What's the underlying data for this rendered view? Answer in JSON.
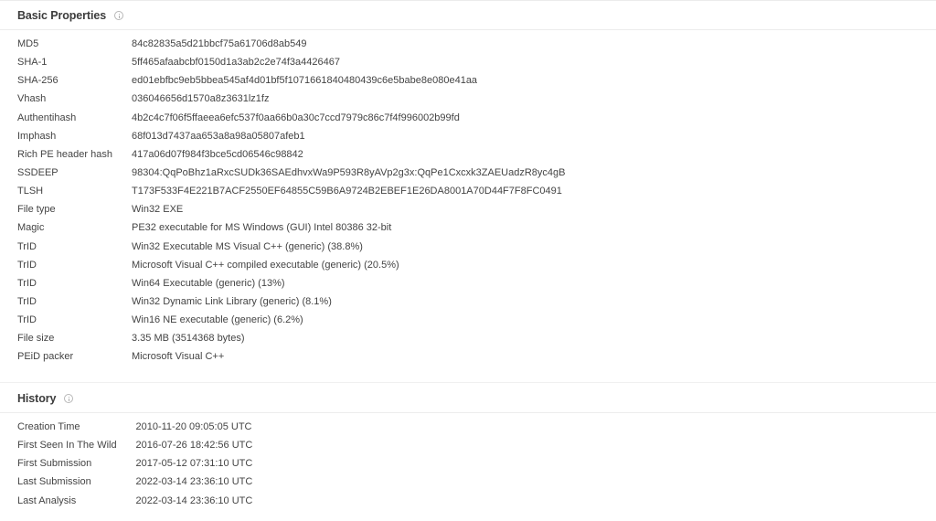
{
  "basic": {
    "title": "Basic Properties",
    "rows": [
      {
        "label": "MD5",
        "value": "84c82835a5d21bbcf75a61706d8ab549"
      },
      {
        "label": "SHA-1",
        "value": "5ff465afaabcbf0150d1a3ab2c2e74f3a4426467"
      },
      {
        "label": "SHA-256",
        "value": "ed01ebfbc9eb5bbea545af4d01bf5f1071661840480439c6e5babe8e080e41aa"
      },
      {
        "label": "Vhash",
        "value": "036046656d1570a8z3631lz1fz"
      },
      {
        "label": "Authentihash",
        "value": "4b2c4c7f06f5ffaeea6efc537f0aa66b0a30c7ccd7979c86c7f4f996002b99fd"
      },
      {
        "label": "Imphash",
        "value": "68f013d7437aa653a8a98a05807afeb1"
      },
      {
        "label": "Rich PE header hash",
        "value": "417a06d07f984f3bce5cd06546c98842"
      },
      {
        "label": "SSDEEP",
        "value": "98304:QqPoBhz1aRxcSUDk36SAEdhvxWa9P593R8yAVp2g3x:QqPe1Cxcxk3ZAEUadzR8yc4gB"
      },
      {
        "label": "TLSH",
        "value": "T173F533F4E221B7ACF2550EF64855C59B6A9724B2EBEF1E26DA8001A70D44F7F8FC0491"
      },
      {
        "label": "File type",
        "value": "Win32 EXE"
      },
      {
        "label": "Magic",
        "value": "PE32 executable for MS Windows (GUI) Intel 80386 32-bit"
      },
      {
        "label": "TrID",
        "value": "Win32 Executable MS Visual C++ (generic) (38.8%)"
      },
      {
        "label": "TrID",
        "value": "Microsoft Visual C++ compiled executable (generic) (20.5%)"
      },
      {
        "label": "TrID",
        "value": "Win64 Executable (generic) (13%)"
      },
      {
        "label": "TrID",
        "value": "Win32 Dynamic Link Library (generic) (8.1%)"
      },
      {
        "label": "TrID",
        "value": "Win16 NE executable (generic) (6.2%)"
      },
      {
        "label": "File size",
        "value": "3.35 MB (3514368 bytes)"
      },
      {
        "label": "PEiD packer",
        "value": "Microsoft Visual C++"
      }
    ]
  },
  "history": {
    "title": "History",
    "rows": [
      {
        "label": "Creation Time",
        "value": "2010-11-20 09:05:05 UTC"
      },
      {
        "label": "First Seen In The Wild",
        "value": "2016-07-26 18:42:56 UTC"
      },
      {
        "label": "First Submission",
        "value": "2017-05-12 07:31:10 UTC"
      },
      {
        "label": "Last Submission",
        "value": "2022-03-14 23:36:10 UTC"
      },
      {
        "label": "Last Analysis",
        "value": "2022-03-14 23:36:10 UTC"
      }
    ]
  }
}
